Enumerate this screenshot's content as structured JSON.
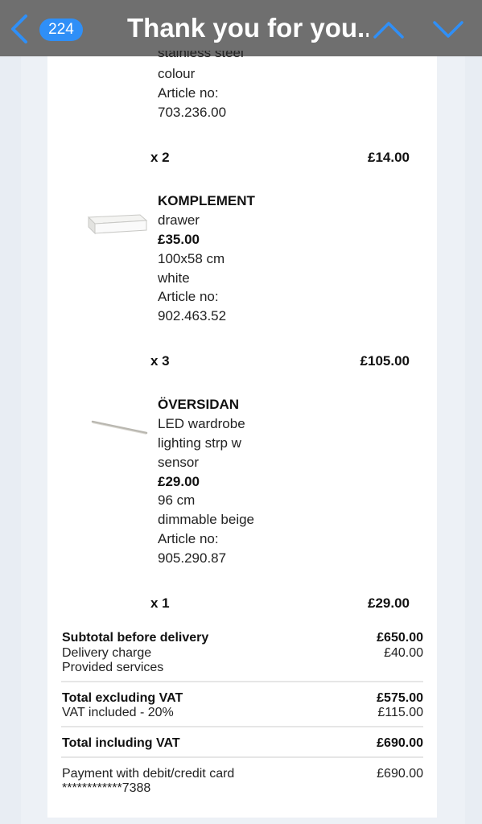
{
  "header": {
    "unread_count": "224",
    "title": "Thank you for you..."
  },
  "items": [
    {
      "tail_partial": "stainless steel",
      "tail_lines": [
        "colour",
        "Article no:",
        "703.236.00"
      ],
      "quantity": "x 2",
      "line_total": "£14.00"
    },
    {
      "name": "KOMPLEMENT",
      "description": "drawer",
      "price": "£35.00",
      "details": [
        "100x58 cm",
        "white",
        "Article no:",
        "902.463.52"
      ],
      "quantity": "x 3",
      "line_total": "£105.00"
    },
    {
      "name": "ÖVERSIDAN",
      "description_lines": [
        "LED wardrobe",
        "lighting strp w",
        "sensor"
      ],
      "price": "£29.00",
      "details": [
        "96 cm",
        "dimmable beige",
        "Article no:",
        "905.290.87"
      ],
      "quantity": "x 1",
      "line_total": "£29.00"
    }
  ],
  "summary": {
    "subtotal_label": "Subtotal before delivery",
    "subtotal_value": "£650.00",
    "delivery_label": "Delivery charge",
    "delivery_value": "£40.00",
    "services_label": "Provided services",
    "total_ex_vat_label": "Total excluding VAT",
    "total_ex_vat_value": "£575.00",
    "vat_label": "VAT included - 20%",
    "vat_value": "£115.00",
    "total_inc_vat_label": "Total including VAT",
    "total_inc_vat_value": "£690.00",
    "payment_label": "Payment with debit/credit card",
    "payment_value": "£690.00",
    "card_number": "************7388"
  },
  "icons": {
    "back": "chevron-left-icon",
    "previous": "chevron-up-icon",
    "next": "chevron-down-icon"
  },
  "colors": {
    "header_bg": "#6f6f6f",
    "badge_bg": "#2f8ff7",
    "accent": "#2f8ff7"
  }
}
